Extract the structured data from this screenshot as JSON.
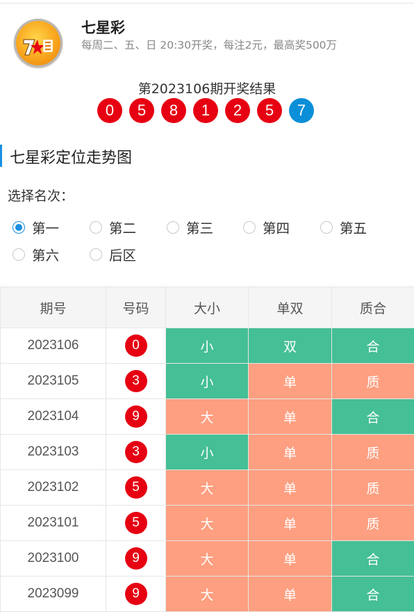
{
  "header": {
    "title": "七星彩",
    "subtitle": "每周二、五、日 20:30开奖，每注2元，最高奖500万",
    "logo_text": "7星彩"
  },
  "draw": {
    "title": "第2023106期开奖结果",
    "numbers": [
      "0",
      "5",
      "8",
      "1",
      "2",
      "5",
      "7"
    ],
    "colors": [
      "red",
      "red",
      "red",
      "red",
      "red",
      "red",
      "blue"
    ]
  },
  "section": {
    "title": "七星彩定位走势图"
  },
  "position_select": {
    "label": "选择名次：",
    "options": [
      "第一",
      "第二",
      "第三",
      "第四",
      "第五",
      "第六",
      "后区"
    ],
    "selected": "第一"
  },
  "table": {
    "headers": [
      "期号",
      "号码",
      "大小",
      "单双",
      "质合"
    ],
    "rows": [
      {
        "issue": "2023106",
        "number": "0",
        "size": "小",
        "parity": "双",
        "prime": "合"
      },
      {
        "issue": "2023105",
        "number": "3",
        "size": "小",
        "parity": "单",
        "prime": "质"
      },
      {
        "issue": "2023104",
        "number": "9",
        "size": "大",
        "parity": "单",
        "prime": "合"
      },
      {
        "issue": "2023103",
        "number": "3",
        "size": "小",
        "parity": "单",
        "prime": "质"
      },
      {
        "issue": "2023102",
        "number": "5",
        "size": "大",
        "parity": "单",
        "prime": "质"
      },
      {
        "issue": "2023101",
        "number": "5",
        "size": "大",
        "parity": "单",
        "prime": "质"
      },
      {
        "issue": "2023100",
        "number": "9",
        "size": "大",
        "parity": "单",
        "prime": "合"
      },
      {
        "issue": "2023099",
        "number": "9",
        "size": "大",
        "parity": "单",
        "prime": "合"
      }
    ]
  },
  "colors": {
    "accent": "#1a8fe3",
    "ball_red": "#e60012",
    "ball_blue": "#0b8fd8",
    "cell_green": "#45bf95",
    "cell_orange": "#fd9f80"
  }
}
